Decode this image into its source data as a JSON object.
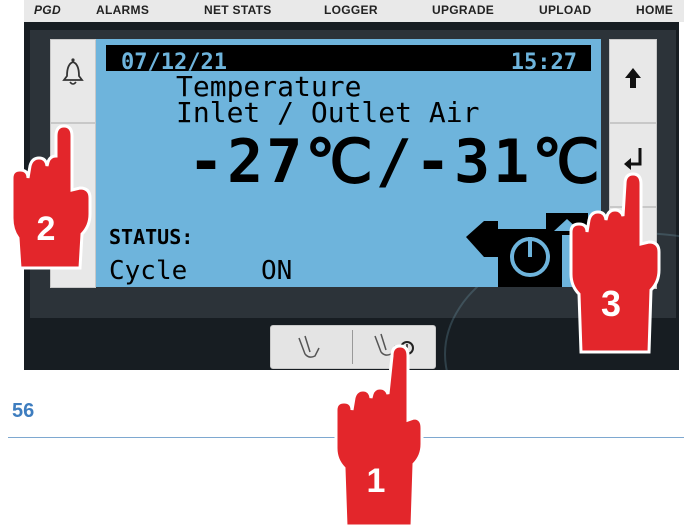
{
  "nav": [
    "PGD",
    "ALARMS",
    "NET STATS",
    "LOGGER",
    "UPGRADE",
    "UPLOAD",
    "HOME"
  ],
  "lcd": {
    "date": "07/12/21",
    "time": "15:27",
    "line1": "Temperature",
    "line2": "Inlet / Outlet Air",
    "reading": "-27℃/-31℃",
    "status_label": "STATUS:",
    "cycle_label": "Cycle",
    "cycle_value": "ON"
  },
  "side_buttons": {
    "left": [
      "bell-icon",
      "blank"
    ],
    "right": [
      "arrow-up-icon",
      "enter-icon",
      "blank"
    ]
  },
  "callouts": [
    "1",
    "2",
    "3"
  ],
  "page_number": "56",
  "colors": {
    "lcd": "#6eb4dc",
    "hand": "#e3262b",
    "page_number": "#3e7dbf"
  }
}
